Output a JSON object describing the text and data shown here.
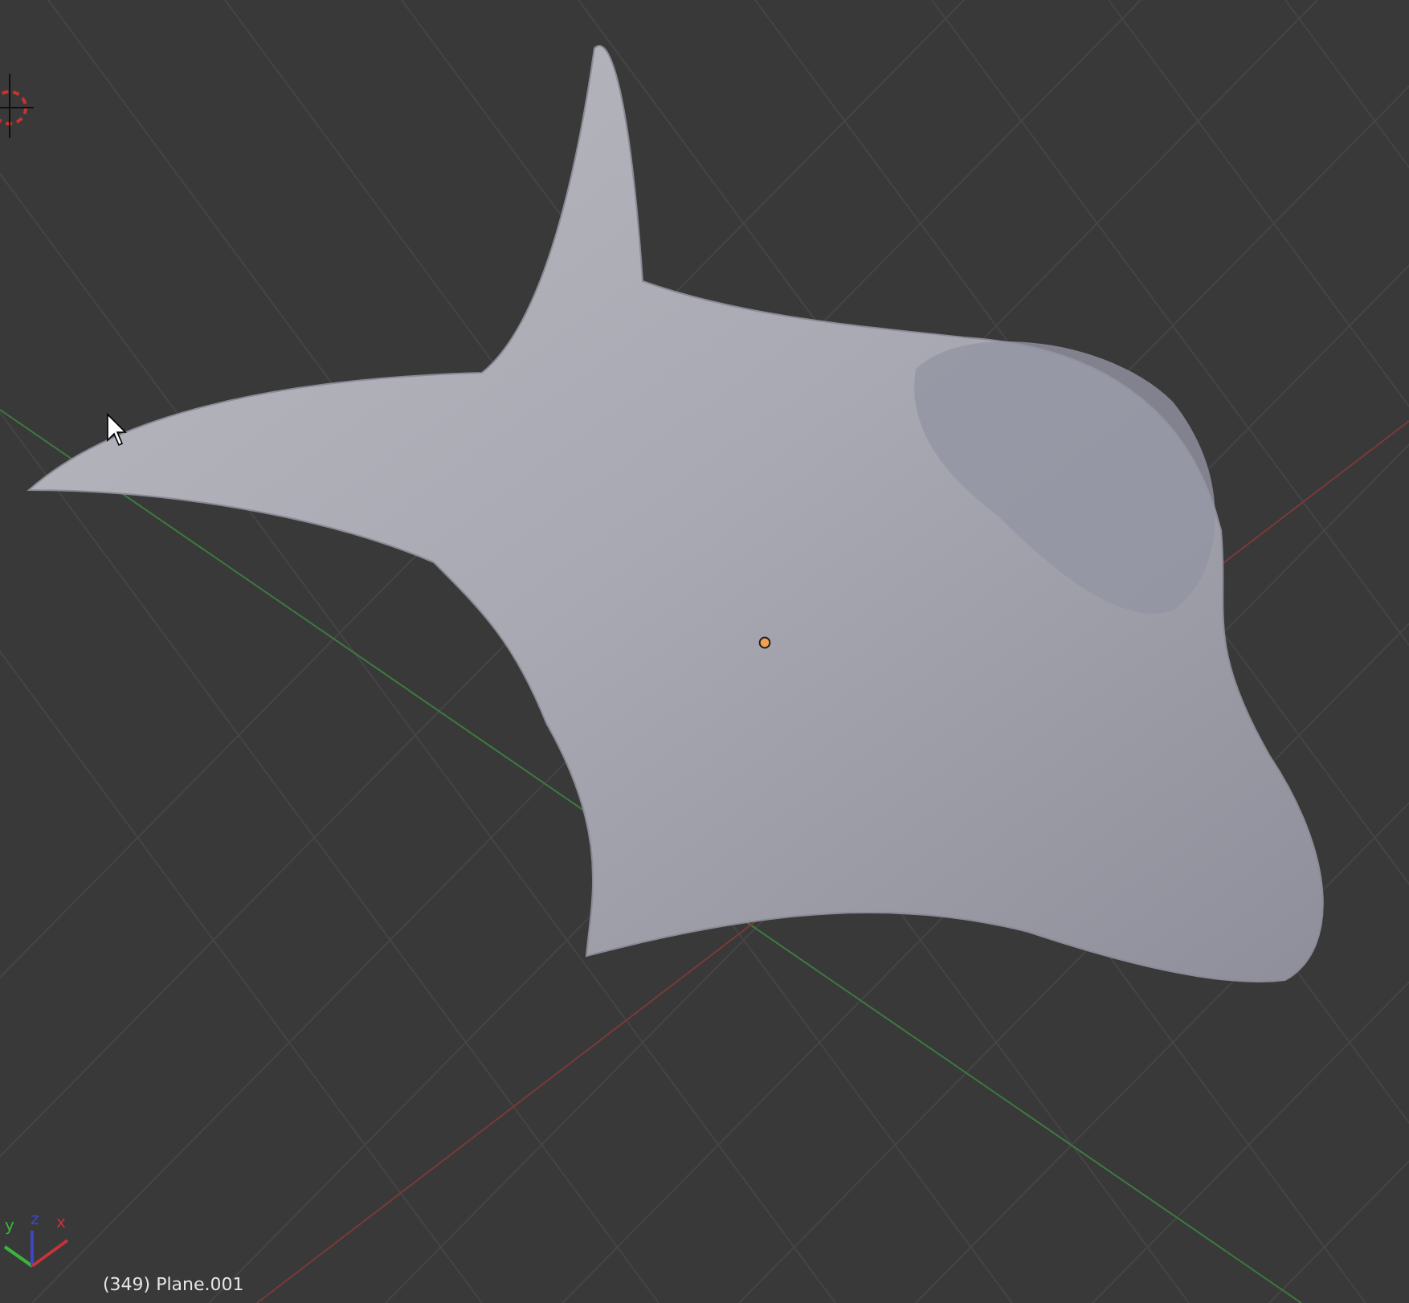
{
  "viewport": {
    "object_label": "(349) Plane.001",
    "axis_labels": [
      {
        "kind": "y",
        "label": "y",
        "color": "#3cb43c"
      },
      {
        "kind": "z",
        "label": "z",
        "color": "#3c46c8"
      },
      {
        "kind": "x",
        "label": "x",
        "color": "#c8323c"
      }
    ]
  }
}
